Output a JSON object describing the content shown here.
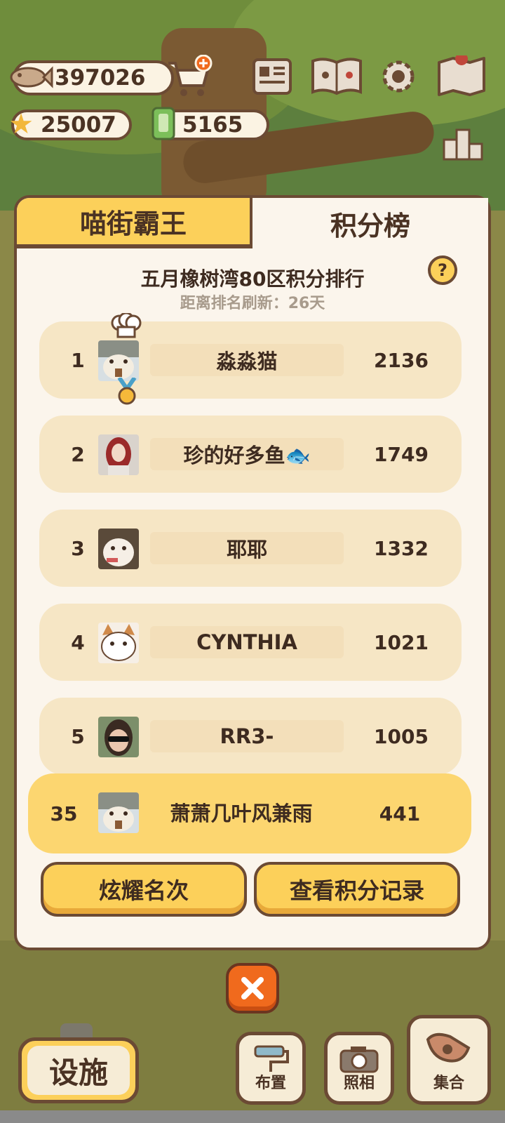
{
  "hud": {
    "fish_coins": "397026",
    "stars": "25007",
    "tickets": "5165",
    "icons": [
      "fish-icon",
      "cart-plus-icon",
      "star-icon",
      "ticket-icon",
      "newspaper-icon",
      "paw-book-icon",
      "gear-icon",
      "map-icon",
      "podium-icon"
    ]
  },
  "leaderboard": {
    "tab_left": "喵街霸王",
    "tab_right": "积分榜",
    "title": "五月橡树湾80区积分排行",
    "subtitle": "距离排名刷新：26天",
    "help_label": "?",
    "rows": [
      {
        "rank": "1",
        "name": "淼淼猫",
        "score": "2136"
      },
      {
        "rank": "2",
        "name": "珍的好多鱼🐟",
        "score": "1749"
      },
      {
        "rank": "3",
        "name": "耶耶",
        "score": "1332"
      },
      {
        "rank": "4",
        "name": "CYNTHIA",
        "score": "1021"
      },
      {
        "rank": "5",
        "name": "RR3-",
        "score": "1005"
      }
    ],
    "me": {
      "rank": "35",
      "name": "萧萧几叶风兼雨",
      "score": "441"
    },
    "show_rank_button": "炫耀名次",
    "view_log_button": "查看积分记录"
  },
  "bottom": {
    "facility": "设施",
    "layout": "布置",
    "photo": "照相",
    "gather": "集合"
  },
  "colors": {
    "brown": "#6b4a34",
    "yellow": "#fcd05a",
    "cream": "#fbf5ec",
    "row": "#f6e6c5",
    "orange": "#f06a1d"
  }
}
